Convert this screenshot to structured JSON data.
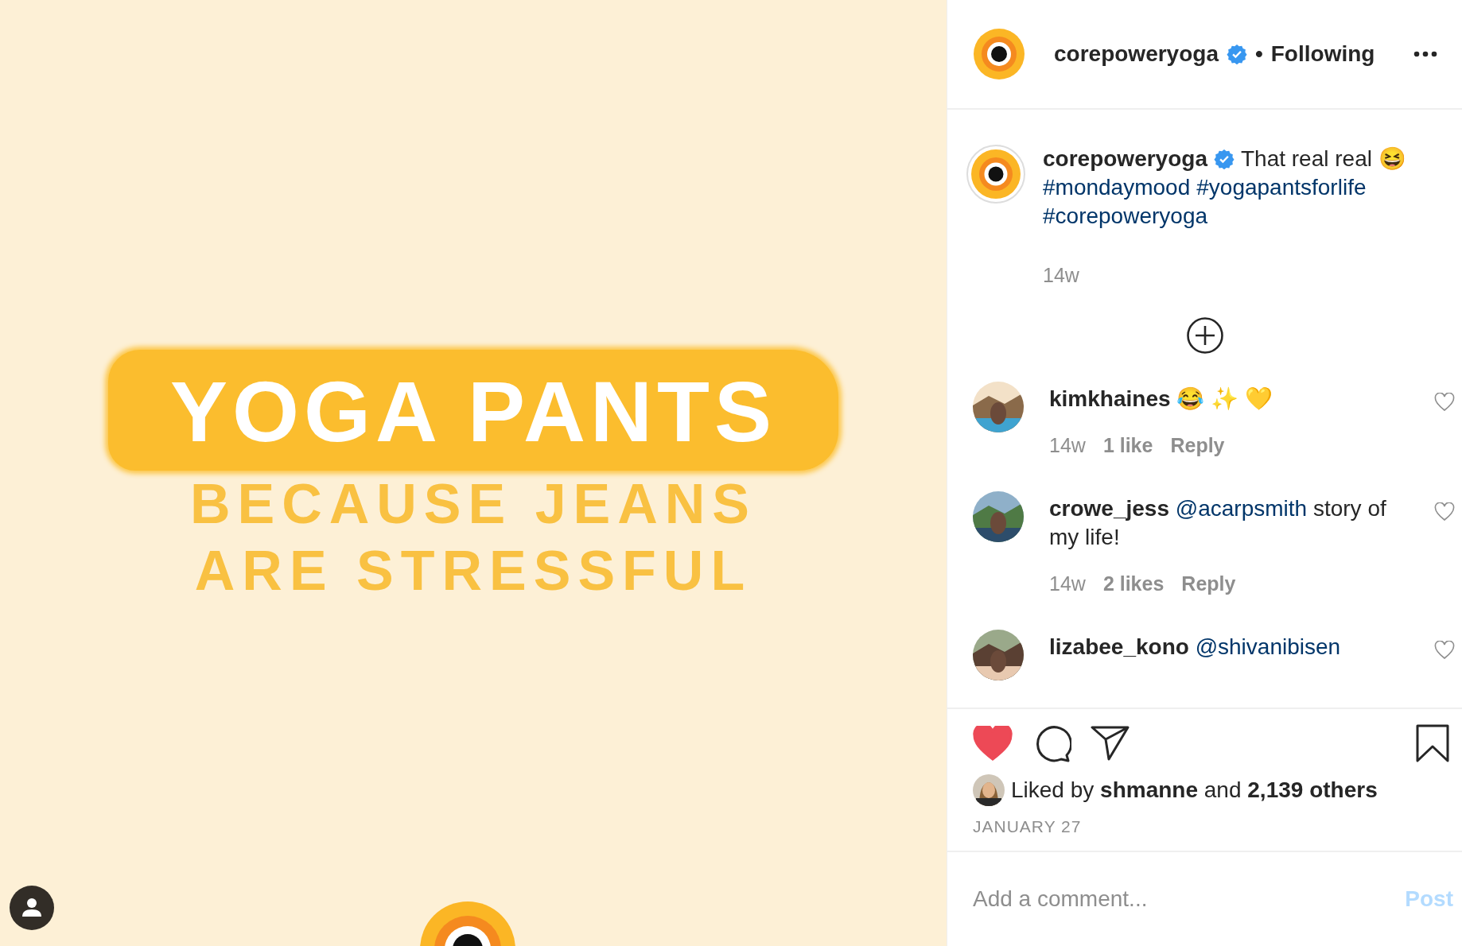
{
  "post_image": {
    "headline": "YOGA PANTS",
    "sublines": [
      "BECAUSE JEANS",
      "ARE STRESSFUL"
    ]
  },
  "header": {
    "username": "corepoweryoga",
    "verified": true,
    "separator": "•",
    "follow_status": "Following"
  },
  "caption": {
    "username": "corepoweryoga",
    "verified": true,
    "text": "That real real 😆",
    "hashtags": [
      "#mondaymood",
      "#yogapantsforlife",
      "#corepoweryoga"
    ],
    "time": "14w"
  },
  "comments": [
    {
      "username": "kimkhaines",
      "parts": [
        {
          "kind": "text",
          "text": "😂 ✨ 💛"
        }
      ],
      "time": "14w",
      "likes": "1 like",
      "reply": "Reply",
      "liked": false
    },
    {
      "username": "crowe_jess",
      "parts": [
        {
          "kind": "mention",
          "text": "@acarpsmith"
        },
        {
          "kind": "text",
          "text": " story of my life!"
        }
      ],
      "time": "14w",
      "likes": "2 likes",
      "reply": "Reply",
      "liked": false
    },
    {
      "username": "lizabee_kono",
      "parts": [
        {
          "kind": "mention",
          "text": "@shivanibisen"
        }
      ],
      "liked": false
    }
  ],
  "actions": {
    "liked": true
  },
  "likes_line": "Liked by **shmanne** and **2,139 others**",
  "date": "JANUARY 27",
  "comment_box": {
    "placeholder": "Add a comment...",
    "post_label": "Post",
    "post_enabled": false
  }
}
